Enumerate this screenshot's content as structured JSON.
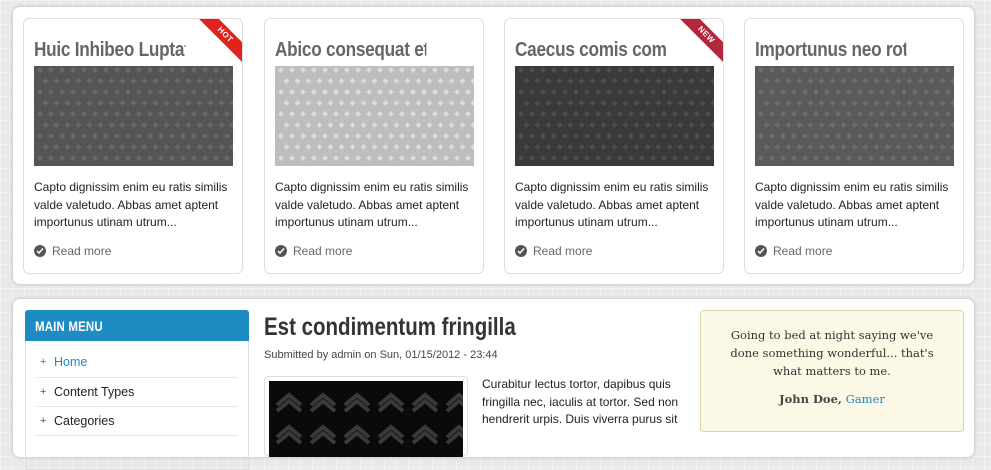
{
  "featured": {
    "cards": [
      {
        "title": "Huic Inhibeo Luptatum...",
        "text": "Capto dignissim enim eu ratis similis valde valetudo. Abbas amet aptent importunus utinam utrum...",
        "read_more": "Read more",
        "ribbon": "HOT",
        "image_tone": "dark"
      },
      {
        "title": "Abico consequat et hos...",
        "text": "Capto dignissim enim eu ratis similis valde valetudo. Abbas amet aptent importunus utinam utrum...",
        "read_more": "Read more",
        "ribbon": "",
        "image_tone": "light"
      },
      {
        "title": "Caecus comis commoveo...",
        "text": "Capto dignissim enim eu ratis similis valde valetudo. Abbas amet aptent importunus utinam utrum...",
        "read_more": "Read more",
        "ribbon": "NEW",
        "image_tone": "darker"
      },
      {
        "title": "Importunus neo roto...",
        "text": "Capto dignissim enim eu ratis similis valde valetudo. Abbas amet aptent importunus utinam utrum...",
        "read_more": "Read more",
        "ribbon": "",
        "image_tone": "dark"
      }
    ]
  },
  "main_menu": {
    "header": "MAIN MENU",
    "items": [
      {
        "label": "Home",
        "active": true
      },
      {
        "label": "Content Types",
        "active": false
      },
      {
        "label": "Categories",
        "active": false
      }
    ]
  },
  "article": {
    "title": "Est condimentum fringilla",
    "submitted": "Submitted by admin on Sun, 01/15/2012 - 23:44",
    "body": "Curabitur lectus tortor, dapibus quis fringilla nec, iaculis at tortor. Sed non hendrerit urpis. Duis viverra purus sit"
  },
  "quote": {
    "text": "Going to bed at night saying we've done something wonderful... that's what matters to me.",
    "author": "John Doe,",
    "role": "Gamer"
  },
  "colors": {
    "accent": "#1e8bc3",
    "ribbon_hot": "#e2211c",
    "ribbon_new": "#b3273a",
    "quote_bg": "#fbf8e6"
  }
}
